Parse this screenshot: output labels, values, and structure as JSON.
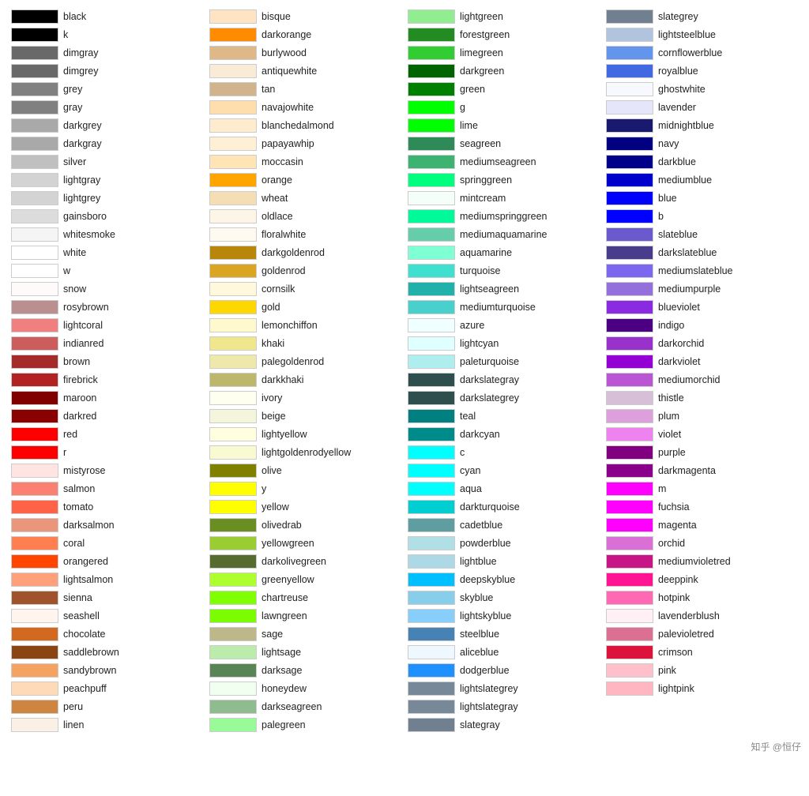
{
  "columns": [
    [
      {
        "name": "black",
        "color": "#000000"
      },
      {
        "name": "k",
        "color": "#000000"
      },
      {
        "name": "dimgray",
        "color": "#696969"
      },
      {
        "name": "dimgrey",
        "color": "#696969"
      },
      {
        "name": "grey",
        "color": "#808080"
      },
      {
        "name": "gray",
        "color": "#808080"
      },
      {
        "name": "darkgrey",
        "color": "#a9a9a9"
      },
      {
        "name": "darkgray",
        "color": "#a9a9a9"
      },
      {
        "name": "silver",
        "color": "#c0c0c0"
      },
      {
        "name": "lightgray",
        "color": "#d3d3d3"
      },
      {
        "name": "lightgrey",
        "color": "#d3d3d3"
      },
      {
        "name": "gainsboro",
        "color": "#dcdcdc"
      },
      {
        "name": "whitesmoke",
        "color": "#f5f5f5"
      },
      {
        "name": "white",
        "color": "#ffffff"
      },
      {
        "name": "w",
        "color": "#ffffff"
      },
      {
        "name": "snow",
        "color": "#fffafa"
      },
      {
        "name": "rosybrown",
        "color": "#bc8f8f"
      },
      {
        "name": "lightcoral",
        "color": "#f08080"
      },
      {
        "name": "indianred",
        "color": "#cd5c5c"
      },
      {
        "name": "brown",
        "color": "#a52a2a"
      },
      {
        "name": "firebrick",
        "color": "#b22222"
      },
      {
        "name": "maroon",
        "color": "#800000"
      },
      {
        "name": "darkred",
        "color": "#8b0000"
      },
      {
        "name": "red",
        "color": "#ff0000"
      },
      {
        "name": "r",
        "color": "#ff0000"
      },
      {
        "name": "mistyrose",
        "color": "#ffe4e1"
      },
      {
        "name": "salmon",
        "color": "#fa8072"
      },
      {
        "name": "tomato",
        "color": "#ff6347"
      },
      {
        "name": "darksalmon",
        "color": "#e9967a"
      },
      {
        "name": "coral",
        "color": "#ff7f50"
      },
      {
        "name": "orangered",
        "color": "#ff4500"
      },
      {
        "name": "lightsalmon",
        "color": "#ffa07a"
      },
      {
        "name": "sienna",
        "color": "#a0522d"
      },
      {
        "name": "seashell",
        "color": "#fff5ee"
      },
      {
        "name": "chocolate",
        "color": "#d2691e"
      },
      {
        "name": "saddlebrown",
        "color": "#8b4513"
      },
      {
        "name": "sandybrown",
        "color": "#f4a460"
      },
      {
        "name": "peachpuff",
        "color": "#ffdab9"
      },
      {
        "name": "peru",
        "color": "#cd853f"
      },
      {
        "name": "linen",
        "color": "#faf0e6"
      }
    ],
    [
      {
        "name": "bisque",
        "color": "#ffe4c4"
      },
      {
        "name": "darkorange",
        "color": "#ff8c00"
      },
      {
        "name": "burlywood",
        "color": "#deb887"
      },
      {
        "name": "antiquewhite",
        "color": "#faebd7"
      },
      {
        "name": "tan",
        "color": "#d2b48c"
      },
      {
        "name": "navajowhite",
        "color": "#ffdead"
      },
      {
        "name": "blanchedalmond",
        "color": "#ffebcd"
      },
      {
        "name": "papayawhip",
        "color": "#ffefd5"
      },
      {
        "name": "moccasin",
        "color": "#ffe4b5"
      },
      {
        "name": "orange",
        "color": "#ffa500"
      },
      {
        "name": "wheat",
        "color": "#f5deb3"
      },
      {
        "name": "oldlace",
        "color": "#fdf5e6"
      },
      {
        "name": "floralwhite",
        "color": "#fffaf0"
      },
      {
        "name": "darkgoldenrod",
        "color": "#b8860b"
      },
      {
        "name": "goldenrod",
        "color": "#daa520"
      },
      {
        "name": "cornsilk",
        "color": "#fff8dc"
      },
      {
        "name": "gold",
        "color": "#ffd700"
      },
      {
        "name": "lemonchiffon",
        "color": "#fffacd"
      },
      {
        "name": "khaki",
        "color": "#f0e68c"
      },
      {
        "name": "palegoldenrod",
        "color": "#eee8aa"
      },
      {
        "name": "darkkhaki",
        "color": "#bdb76b"
      },
      {
        "name": "ivory",
        "color": "#fffff0"
      },
      {
        "name": "beige",
        "color": "#f5f5dc"
      },
      {
        "name": "lightyellow",
        "color": "#ffffe0"
      },
      {
        "name": "lightgoldenrodyellow",
        "color": "#fafad2"
      },
      {
        "name": "olive",
        "color": "#808000"
      },
      {
        "name": "y",
        "color": "#ffff00"
      },
      {
        "name": "yellow",
        "color": "#ffff00"
      },
      {
        "name": "olivedrab",
        "color": "#6b8e23"
      },
      {
        "name": "yellowgreen",
        "color": "#9acd32"
      },
      {
        "name": "darkolivegreen",
        "color": "#556b2f"
      },
      {
        "name": "greenyellow",
        "color": "#adff2f"
      },
      {
        "name": "chartreuse",
        "color": "#7fff00"
      },
      {
        "name": "lawngreen",
        "color": "#7cfc00"
      },
      {
        "name": "sage",
        "color": "#bcb88a"
      },
      {
        "name": "lightsage",
        "color": "#bcecac"
      },
      {
        "name": "darksage",
        "color": "#598556"
      },
      {
        "name": "honeydew",
        "color": "#f0fff0"
      },
      {
        "name": "darkseagreen",
        "color": "#8fbc8f"
      },
      {
        "name": "palegreen",
        "color": "#98fb98"
      }
    ],
    [
      {
        "name": "lightgreen",
        "color": "#90ee90"
      },
      {
        "name": "forestgreen",
        "color": "#228b22"
      },
      {
        "name": "limegreen",
        "color": "#32cd32"
      },
      {
        "name": "darkgreen",
        "color": "#006400"
      },
      {
        "name": "green",
        "color": "#008000"
      },
      {
        "name": "g",
        "color": "#00ff00"
      },
      {
        "name": "lime",
        "color": "#00ff00"
      },
      {
        "name": "seagreen",
        "color": "#2e8b57"
      },
      {
        "name": "mediumseagreen",
        "color": "#3cb371"
      },
      {
        "name": "springgreen",
        "color": "#00ff7f"
      },
      {
        "name": "mintcream",
        "color": "#f5fffa"
      },
      {
        "name": "mediumspringgreen",
        "color": "#00fa9a"
      },
      {
        "name": "mediumaquamarine",
        "color": "#66cdaa"
      },
      {
        "name": "aquamarine",
        "color": "#7fffd4"
      },
      {
        "name": "turquoise",
        "color": "#40e0d0"
      },
      {
        "name": "lightseagreen",
        "color": "#20b2aa"
      },
      {
        "name": "mediumturquoise",
        "color": "#48d1cc"
      },
      {
        "name": "azure",
        "color": "#f0ffff"
      },
      {
        "name": "lightcyan",
        "color": "#e0ffff"
      },
      {
        "name": "paleturquoise",
        "color": "#afeeee"
      },
      {
        "name": "darkslategray",
        "color": "#2f4f4f"
      },
      {
        "name": "darkslategrey",
        "color": "#2f4f4f"
      },
      {
        "name": "teal",
        "color": "#008080"
      },
      {
        "name": "darkcyan",
        "color": "#008b8b"
      },
      {
        "name": "c",
        "color": "#00ffff"
      },
      {
        "name": "cyan",
        "color": "#00ffff"
      },
      {
        "name": "aqua",
        "color": "#00ffff"
      },
      {
        "name": "darkturquoise",
        "color": "#00ced1"
      },
      {
        "name": "cadetblue",
        "color": "#5f9ea0"
      },
      {
        "name": "powderblue",
        "color": "#b0e0e6"
      },
      {
        "name": "lightblue",
        "color": "#add8e6"
      },
      {
        "name": "deepskyblue",
        "color": "#00bfff"
      },
      {
        "name": "skyblue",
        "color": "#87ceeb"
      },
      {
        "name": "lightskyblue",
        "color": "#87cefa"
      },
      {
        "name": "steelblue",
        "color": "#4682b4"
      },
      {
        "name": "aliceblue",
        "color": "#f0f8ff"
      },
      {
        "name": "dodgerblue",
        "color": "#1e90ff"
      },
      {
        "name": "lightslategrey",
        "color": "#778899"
      },
      {
        "name": "lightslategray",
        "color": "#778899"
      },
      {
        "name": "slategray",
        "color": "#708090"
      }
    ],
    [
      {
        "name": "slategrey",
        "color": "#708090"
      },
      {
        "name": "lightsteelblue",
        "color": "#b0c4de"
      },
      {
        "name": "cornflowerblue",
        "color": "#6495ed"
      },
      {
        "name": "royalblue",
        "color": "#4169e1"
      },
      {
        "name": "ghostwhite",
        "color": "#f8f8ff"
      },
      {
        "name": "lavender",
        "color": "#e6e6fa"
      },
      {
        "name": "midnightblue",
        "color": "#191970"
      },
      {
        "name": "navy",
        "color": "#000080"
      },
      {
        "name": "darkblue",
        "color": "#00008b"
      },
      {
        "name": "mediumblue",
        "color": "#0000cd"
      },
      {
        "name": "blue",
        "color": "#0000ff"
      },
      {
        "name": "b",
        "color": "#0000ff"
      },
      {
        "name": "slateblue",
        "color": "#6a5acd"
      },
      {
        "name": "darkslateblue",
        "color": "#483d8b"
      },
      {
        "name": "mediumslateblue",
        "color": "#7b68ee"
      },
      {
        "name": "mediumpurple",
        "color": "#9370db"
      },
      {
        "name": "blueviolet",
        "color": "#8a2be2"
      },
      {
        "name": "indigo",
        "color": "#4b0082"
      },
      {
        "name": "darkorchid",
        "color": "#9932cc"
      },
      {
        "name": "darkviolet",
        "color": "#9400d3"
      },
      {
        "name": "mediumorchid",
        "color": "#ba55d3"
      },
      {
        "name": "thistle",
        "color": "#d8bfd8"
      },
      {
        "name": "plum",
        "color": "#dda0dd"
      },
      {
        "name": "violet",
        "color": "#ee82ee"
      },
      {
        "name": "purple",
        "color": "#800080"
      },
      {
        "name": "darkmagenta",
        "color": "#8b008b"
      },
      {
        "name": "m",
        "color": "#ff00ff"
      },
      {
        "name": "fuchsia",
        "color": "#ff00ff"
      },
      {
        "name": "magenta",
        "color": "#ff00ff"
      },
      {
        "name": "orchid",
        "color": "#da70d6"
      },
      {
        "name": "mediumvioletred",
        "color": "#c71585"
      },
      {
        "name": "deeppink",
        "color": "#ff1493"
      },
      {
        "name": "hotpink",
        "color": "#ff69b4"
      },
      {
        "name": "lavenderblush",
        "color": "#fff0f5"
      },
      {
        "name": "palevioletred",
        "color": "#db7093"
      },
      {
        "name": "crimson",
        "color": "#dc143c"
      },
      {
        "name": "pink",
        "color": "#ffc0cb"
      },
      {
        "name": "lightpink",
        "color": "#ffb6c1"
      }
    ]
  ],
  "watermark": "知乎 @恒仔"
}
